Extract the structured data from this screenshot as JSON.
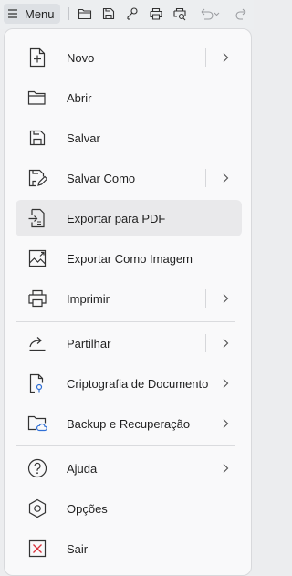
{
  "toolbar": {
    "menu_label": "Menu",
    "icons": [
      "open-folder-icon",
      "save-icon",
      "share-icon",
      "print-icon",
      "print-preview-icon",
      "undo-icon",
      "redo-icon"
    ]
  },
  "menu": {
    "items": [
      {
        "label": "Novo",
        "icon": "new-document-icon",
        "has_submenu": true
      },
      {
        "label": "Abrir",
        "icon": "open-folder-icon",
        "has_submenu": false
      },
      {
        "label": "Salvar",
        "icon": "save-icon",
        "has_submenu": false
      },
      {
        "label": "Salvar Como",
        "icon": "save-as-icon",
        "has_submenu": true
      },
      {
        "label": "Exportar para PDF",
        "icon": "export-pdf-icon",
        "has_submenu": false,
        "selected": true
      },
      {
        "label": "Exportar Como Imagem",
        "icon": "export-image-icon",
        "has_submenu": false
      },
      {
        "label": "Imprimir",
        "icon": "print-icon",
        "has_submenu": true
      },
      {
        "label": "Partilhar",
        "icon": "share-icon",
        "has_submenu": true
      },
      {
        "label": "Criptografia de Documento",
        "icon": "encrypt-document-icon",
        "has_submenu": true
      },
      {
        "label": "Backup e Recuperação",
        "icon": "backup-cloud-icon",
        "has_submenu": true
      },
      {
        "label": "Ajuda",
        "icon": "help-icon",
        "has_submenu": true
      },
      {
        "label": "Opções",
        "icon": "options-icon",
        "has_submenu": false
      },
      {
        "label": "Sair",
        "icon": "exit-icon",
        "has_submenu": false
      }
    ]
  },
  "colors": {
    "accent_exit": "#d9323b",
    "panel_bg": "#f9f9fa",
    "selected_bg": "#e9e9eb"
  }
}
